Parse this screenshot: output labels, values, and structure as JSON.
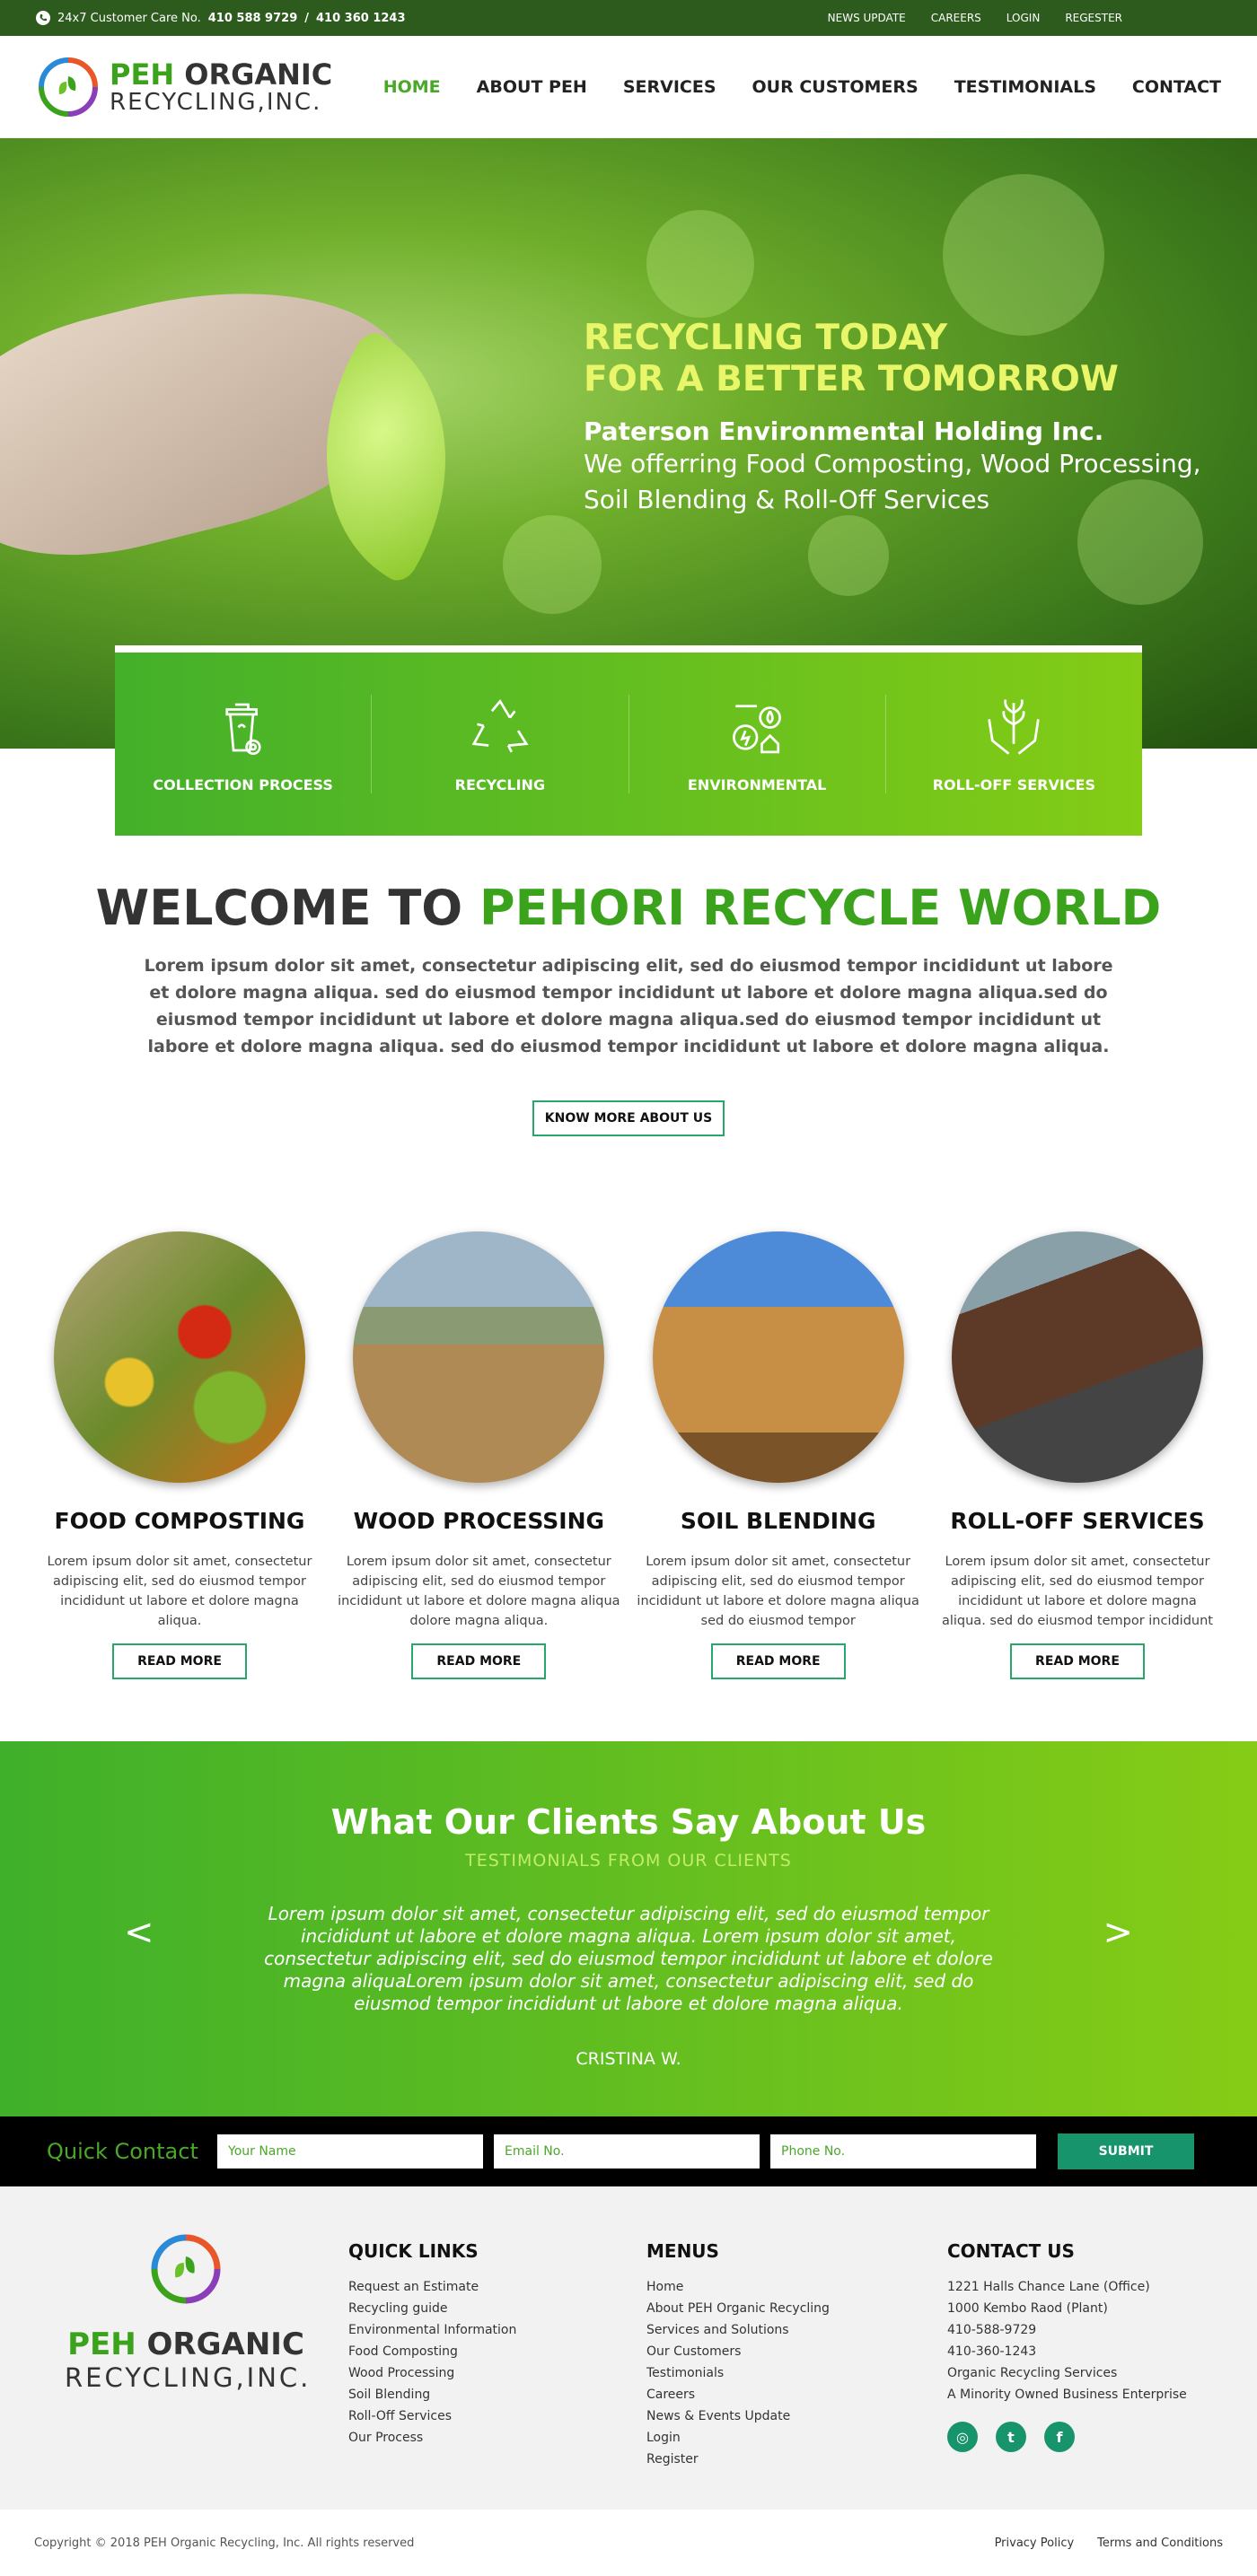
{
  "topbar": {
    "care_label": "24x7 Customer Care No.",
    "phone1": "410 588 9729",
    "sep": "/",
    "phone2": "410 360 1243",
    "links": [
      "NEWS UPDATE",
      "CAREERS",
      "LOGIN",
      "REGESTER"
    ]
  },
  "brand": {
    "line1_a": "PEH",
    "line1_b": "ORGANIC",
    "line2": "RECYCLING,INC."
  },
  "nav": [
    "HOME",
    "ABOUT PEH",
    "SERVICES",
    "OUR CUSTOMERS",
    "TESTIMONIALS",
    "CONTACT"
  ],
  "hero": {
    "headline1": "RECYCLING TODAY",
    "headline2": "FOR A BETTER TOMORROW",
    "company": "Paterson Environmental Holding Inc.",
    "desc1": "We offerring Food Composting, Wood Processing,",
    "desc2": "Soil Blending & Roll-Off Services"
  },
  "strip": [
    "COLLECTION PROCESS",
    "RECYCLING",
    "ENVIRONMENTAL",
    "ROLL-OFF SERVICES"
  ],
  "welcome": {
    "title_a": "WELCOME TO",
    "title_b": "PEHORI RECYCLE WORLD",
    "body": "Lorem ipsum dolor sit amet, consectetur adipiscing elit, sed do eiusmod tempor incididunt ut labore et dolore magna aliqua. sed do eiusmod tempor incididunt ut labore et dolore magna aliqua.sed do eiusmod tempor incididunt ut labore et dolore magna aliqua.sed do eiusmod tempor incididunt ut labore et dolore magna aliqua. sed do eiusmod tempor incididunt ut labore et dolore magna aliqua.",
    "button": "KNOW MORE ABOUT US"
  },
  "cards": [
    {
      "title": "FOOD COMPOSTING",
      "text": "Lorem ipsum dolor sit amet, consectetur adipiscing elit, sed do eiusmod tempor incididunt ut labore et dolore magna aliqua.",
      "button": "READ MORE"
    },
    {
      "title": "WOOD PROCESSING",
      "text": "Lorem ipsum dolor sit amet, consectetur adipiscing elit, sed do eiusmod tempor incididunt ut labore et dolore magna aliqua  dolore magna aliqua.",
      "button": "READ MORE"
    },
    {
      "title": "SOIL BLENDING",
      "text": "Lorem ipsum dolor sit amet, consectetur adipiscing elit, sed do eiusmod tempor incididunt ut labore et dolore magna aliqua sed do eiusmod tempor",
      "button": "READ MORE"
    },
    {
      "title": "ROLL-OFF SERVICES",
      "text": "Lorem ipsum dolor sit amet, consectetur adipiscing elit, sed do eiusmod tempor incididunt ut labore et dolore magna aliqua. sed do eiusmod tempor incididunt",
      "button": "READ MORE"
    }
  ],
  "testimonials": {
    "title": "What Our Clients Say About Us",
    "subtitle": "TESTIMONIALS FROM OUR CLIENTS",
    "quote": "Lorem ipsum dolor sit amet, consectetur adipiscing elit, sed do eiusmod tempor incididunt ut labore et dolore magna aliqua. Lorem ipsum dolor sit amet, consectetur adipiscing elit, sed do eiusmod tempor incididunt ut labore et dolore magna aliquaLorem ipsum dolor sit amet, consectetur adipiscing elit, sed do eiusmod tempor incididunt ut labore et dolore magna aliqua.",
    "author": "CRISTINA W.",
    "prev": "<",
    "next": ">"
  },
  "quick_contact": {
    "label": "Quick Contact",
    "name_placeholder": "Your Name",
    "email_placeholder": "Email No.",
    "phone_placeholder": "Phone No.",
    "submit": "SUBMIT"
  },
  "footer": {
    "quick_links_title": "QUICK LINKS",
    "quick_links": [
      "Request an Estimate",
      "Recycling guide",
      "Environmental Information",
      "Food Composting",
      "Wood Processing",
      "Soil Blending",
      "Roll-Off Services",
      "Our Process"
    ],
    "menus_title": "MENUS",
    "menus": [
      "Home",
      "About PEH Organic Recycling",
      "Services and Solutions",
      "Our Customers",
      "Testimonials",
      "Careers",
      "News & Events Update",
      "Login",
      "Register"
    ],
    "contact_title": "CONTACT US",
    "contact": [
      "1221 Halls Chance Lane (Office)",
      "1000 Kembo Raod (Plant)",
      "410-588-9729",
      "410-360-1243",
      "Organic Recycling Services",
      "A Minority Owned Business Enterprise"
    ],
    "social": [
      "instagram-icon",
      "twitter-icon",
      "facebook-icon"
    ]
  },
  "copyright": {
    "text": "Copyright © 2018  PEH Organic Recycling, Inc.   All rights reserved",
    "links": [
      "Privacy Policy",
      "Terms and Conditions"
    ]
  },
  "colors": {
    "brand_green": "#3aa21b",
    "dark_green": "#2d5b1e",
    "teal": "#17946b",
    "lime": "#84cc16"
  }
}
